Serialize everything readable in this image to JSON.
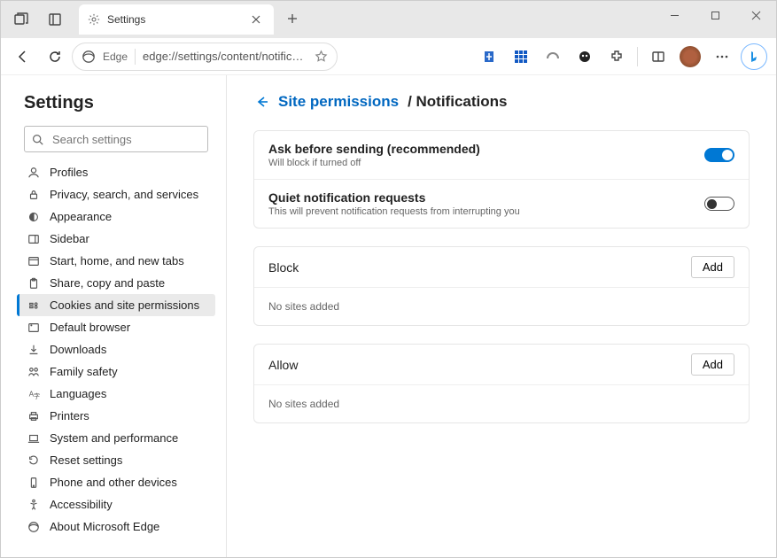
{
  "window": {
    "tab_title": "Settings",
    "address_label": "Edge",
    "address_url": "edge://settings/content/notificat..."
  },
  "sidebar": {
    "title": "Settings",
    "search_placeholder": "Search settings",
    "items": [
      {
        "label": "Profiles"
      },
      {
        "label": "Privacy, search, and services"
      },
      {
        "label": "Appearance"
      },
      {
        "label": "Sidebar"
      },
      {
        "label": "Start, home, and new tabs"
      },
      {
        "label": "Share, copy and paste"
      },
      {
        "label": "Cookies and site permissions"
      },
      {
        "label": "Default browser"
      },
      {
        "label": "Downloads"
      },
      {
        "label": "Family safety"
      },
      {
        "label": "Languages"
      },
      {
        "label": "Printers"
      },
      {
        "label": "System and performance"
      },
      {
        "label": "Reset settings"
      },
      {
        "label": "Phone and other devices"
      },
      {
        "label": "Accessibility"
      },
      {
        "label": "About Microsoft Edge"
      }
    ]
  },
  "breadcrumb": {
    "parent": "Site permissions",
    "current": "/ Notifications"
  },
  "options": [
    {
      "title": "Ask before sending (recommended)",
      "sub": "Will block if turned off",
      "on": true
    },
    {
      "title": "Quiet notification requests",
      "sub": "This will prevent notification requests from interrupting you",
      "on": false
    }
  ],
  "block": {
    "title": "Block",
    "add": "Add",
    "empty": "No sites added"
  },
  "allow": {
    "title": "Allow",
    "add": "Add",
    "empty": "No sites added"
  }
}
